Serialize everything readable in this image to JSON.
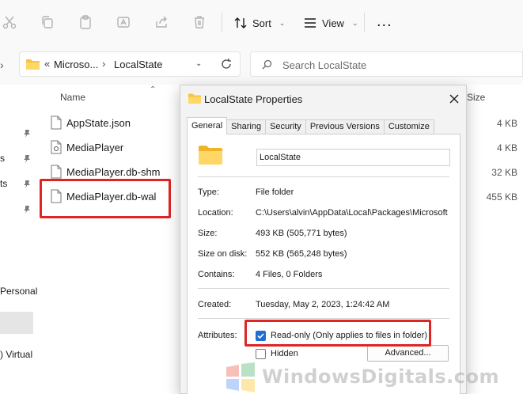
{
  "toolbar": {
    "sort_label": "Sort",
    "view_label": "View",
    "more_label": "..."
  },
  "address": {
    "overflow": "«",
    "crumbs": [
      "Microso...",
      "LocalState"
    ],
    "search_placeholder": "Search LocalState"
  },
  "nav_fragments": [
    "s",
    "ts",
    "Personal",
    ") Virtual"
  ],
  "file_list": {
    "col_name": "Name",
    "col_size": "Size",
    "files": [
      {
        "name": "AppState.json",
        "size": "4 KB",
        "icon": "json-file-icon"
      },
      {
        "name": "MediaPlayer",
        "size": "4 KB",
        "icon": "settings-file-icon"
      },
      {
        "name": "MediaPlayer.db-shm",
        "size": "32 KB",
        "icon": "file-icon"
      },
      {
        "name": "MediaPlayer.db-wal",
        "size": "455 KB",
        "icon": "file-icon"
      }
    ]
  },
  "dialog": {
    "title": "LocalState Properties",
    "tabs": [
      "General",
      "Sharing",
      "Security",
      "Previous Versions",
      "Customize"
    ],
    "active_tab": "General",
    "folder_name": "LocalState",
    "props": {
      "type_label": "Type:",
      "type_value": "File folder",
      "location_label": "Location:",
      "location_value": "C:\\Users\\alvin\\AppData\\Local\\Packages\\Microsoft",
      "size_label": "Size:",
      "size_value": "493 KB (505,771 bytes)",
      "sizeondisk_label": "Size on disk:",
      "sizeondisk_value": "552 KB (565,248 bytes)",
      "contains_label": "Contains:",
      "contains_value": "4 Files, 0 Folders",
      "created_label": "Created:",
      "created_value": "Tuesday, May 2, 2023, 1:24:42 AM",
      "attributes_label": "Attributes:"
    },
    "readonly_label": "Read-only (Only applies to files in folder)",
    "readonly_checked": true,
    "hidden_label": "Hidden",
    "hidden_checked": false,
    "advanced_label": "Advanced..."
  },
  "highlight_color": "#e02424",
  "accent_color": "#1f6fd2",
  "watermark": "WindowsDigitals.com"
}
